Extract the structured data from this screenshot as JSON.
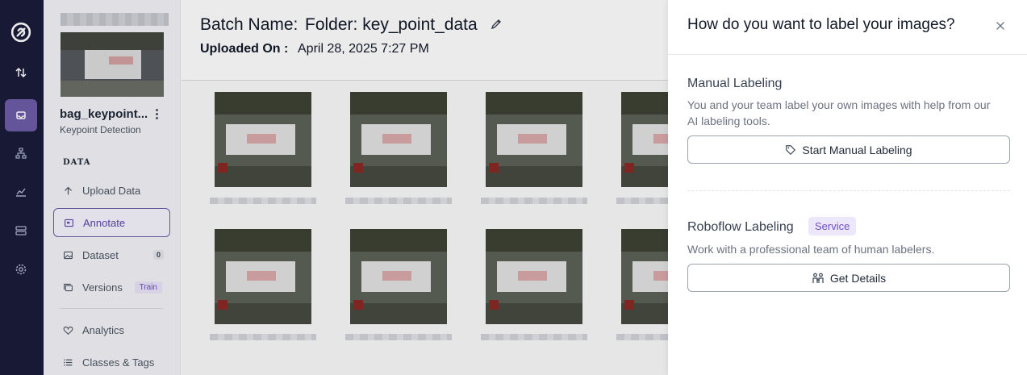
{
  "sidebar": {
    "project_name": "bag_keypoint...",
    "project_type": "Keypoint Detection",
    "section_label": "DATA",
    "items": [
      {
        "label": "Upload Data"
      },
      {
        "label": "Annotate"
      },
      {
        "label": "Dataset",
        "badge": "0"
      },
      {
        "label": "Versions",
        "badge": "Train"
      },
      {
        "label": "Analytics"
      },
      {
        "label": "Classes & Tags"
      }
    ]
  },
  "header": {
    "batch_label": "Batch Name:",
    "batch_value": "Folder: key_point_data",
    "uploaded_label": "Uploaded On :",
    "uploaded_value": "April 28, 2025 7:27 PM"
  },
  "drawer": {
    "title": "How do you want to label your images?",
    "manual": {
      "title": "Manual Labeling",
      "description": "You and your team label your own images with help from our AI labeling tools.",
      "button": "Start Manual Labeling"
    },
    "roboflow": {
      "title": "Roboflow Labeling",
      "badge": "Service",
      "description": "Work with a professional team of human labelers.",
      "button": "Get Details"
    }
  },
  "colors": {
    "rail_bg": "#1b1c3a",
    "accent": "#6d5ca8",
    "badge_purple": "#6d4fc2"
  },
  "icons": [
    "roboflow-logo-icon",
    "swap-arrows-icon",
    "inbox-icon",
    "hierarchy-icon",
    "chart-icon",
    "database-icon",
    "gear-icon",
    "upload-arrow-icon",
    "annotate-icon",
    "dataset-image-icon",
    "versions-icon",
    "analytics-heart-icon",
    "list-icon",
    "pencil-icon",
    "close-icon",
    "tag-icon",
    "people-icon"
  ]
}
